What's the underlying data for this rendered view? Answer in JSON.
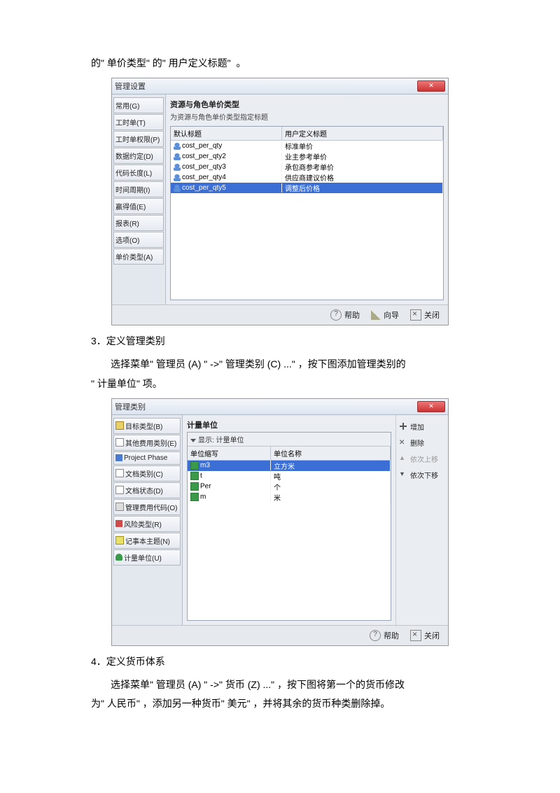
{
  "text": {
    "intro1_a": "的\" 单价类型\" 的\" 用户定义标题\"",
    "intro1_b": "。",
    "sec3_title": "3．定义管理类别",
    "sec3_body": "选择菜单\" 管理员  (A) \"  ->\"  管理类别 (C) ...\"  ，按下图添加管理类别的",
    "sec3_body2": "\"  计量单位\" 项。",
    "sec4_title": "4．定义货币体系",
    "sec4_body": "选择菜单\" 管理员  (A) \"  ->\"  货币 (Z) ...\"  ，按下图将第一个的货币修改",
    "sec4_body2": "为\" 人民币\"  ，添加另一种货币\" 美元\"     ，并将其余的货币种类删除掉。"
  },
  "dlg1": {
    "title": "管理设置",
    "side": [
      "常用(G)",
      "工时单(T)",
      "工时单权限(P)",
      "数据约定(D)",
      "代码长度(L)",
      "时间周期(I)",
      "赢得值(E)",
      "报表(R)",
      "选项(O)",
      "单价类型(A)"
    ],
    "pane_title": "资源与角色单价类型",
    "pane_sub": "为资源与角色单价类型指定标题",
    "col1": "默认标题",
    "col2": "用户定义标题",
    "rows": [
      {
        "a": "cost_per_qty",
        "b": "标准单价"
      },
      {
        "a": "cost_per_qty2",
        "b": "业主参考单价"
      },
      {
        "a": "cost_per_qty3",
        "b": "承包商参考单价"
      },
      {
        "a": "cost_per_qty4",
        "b": "供应商建议价格"
      },
      {
        "a": "cost_per_qty5",
        "b": "调整后价格"
      }
    ],
    "btns": {
      "help": "帮助",
      "wiz": "向导",
      "close": "关闭"
    }
  },
  "dlg2": {
    "title": "管理类别",
    "side": [
      {
        "ic": "ic-plus",
        "t": "目标类型(B)"
      },
      {
        "ic": "ic-doc",
        "t": "其他费用类别(E)"
      },
      {
        "ic": "ic-flow",
        "t": "Project Phase"
      },
      {
        "ic": "ic-doc",
        "t": "文档类别(C)"
      },
      {
        "ic": "ic-doc",
        "t": "文档状态(D)"
      },
      {
        "ic": "ic-card",
        "t": "管理费用代码(O)"
      },
      {
        "ic": "ic-arrow",
        "t": "风险类型(R)"
      },
      {
        "ic": "ic-note",
        "t": "记事本主题(N)"
      },
      {
        "ic": "ic-cyl",
        "t": "计量单位(U)"
      }
    ],
    "pane_title": "计量单位",
    "subhdr": "显示: 计量单位",
    "col1": "单位缩写",
    "col2": "单位名称",
    "rows": [
      {
        "a": "m3",
        "b": "立方米"
      },
      {
        "a": "t",
        "b": "吨"
      },
      {
        "a": "Per",
        "b": "个"
      },
      {
        "a": "m",
        "b": "米"
      }
    ],
    "rbtns": {
      "add": "增加",
      "del": "删除",
      "up": "依次上移",
      "dn": "依次下移"
    },
    "btns": {
      "help": "帮助",
      "close": "关闭"
    }
  }
}
